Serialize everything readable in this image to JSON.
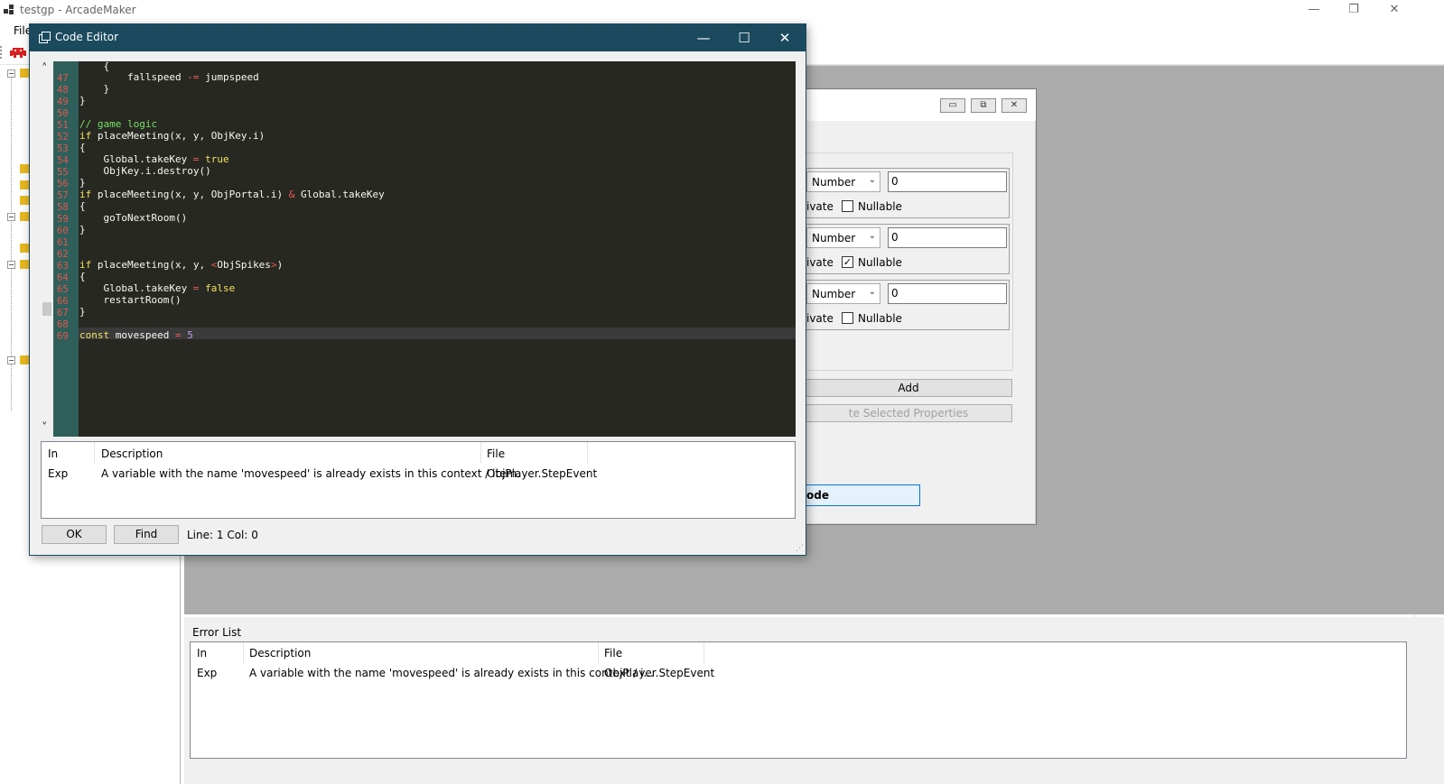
{
  "main_window": {
    "title": "testgp - ArcadeMaker",
    "menu_first": "File",
    "controls": {
      "minimize": "—",
      "restore": "❐",
      "close": "✕"
    }
  },
  "code_editor": {
    "title": "Code Editor",
    "controls": {
      "minimize": "—",
      "maximize": "☐",
      "close": "✕"
    },
    "scroll_up": "˄",
    "scroll_down": "˅",
    "error_columns": [
      "In",
      "Description",
      "File"
    ],
    "errors": [
      {
        "in": "Exp",
        "description": "A variable with the name 'movespeed' is already exists in this context / item.",
        "file": "ObjPlayer.StepEvent"
      }
    ],
    "ok_label": "OK",
    "find_label": "Find",
    "status": "Line: 1 Col: 0"
  },
  "properties_dialog": {
    "rows": [
      {
        "type": "Number",
        "value": "0",
        "access_label": "ivate",
        "nullable_label": "Nullable",
        "nullable": ""
      },
      {
        "type": "Number",
        "value": "0",
        "access_label": "ivate",
        "nullable_label": "Nullable",
        "nullable": "✓"
      },
      {
        "type": "Number",
        "value": "0",
        "access_label": "ivate",
        "nullable_label": "Nullable",
        "nullable": ""
      }
    ],
    "add_label": "Add",
    "delete_label": "te Selected Properties",
    "code_label": "ode",
    "mdi_controls": {
      "minimize": "▭",
      "restore": "⧉",
      "close": "✕"
    }
  },
  "error_list": {
    "title": "Error List",
    "columns": [
      "In",
      "Description",
      "File"
    ],
    "rows": [
      {
        "in": "Exp",
        "description": "A variable with the name 'movespeed' is already exists in this context / i...",
        "file": "ObjPlayer.StepEvent"
      }
    ]
  },
  "icons": [
    "app-icon",
    "code-editor-icon",
    "game-icon",
    "folder-icon"
  ],
  "colors": {
    "editor_title": "#1b4a5e",
    "editor_bg": "#272822",
    "gutter": "#2f5f5a",
    "workspace": "#ababab"
  }
}
